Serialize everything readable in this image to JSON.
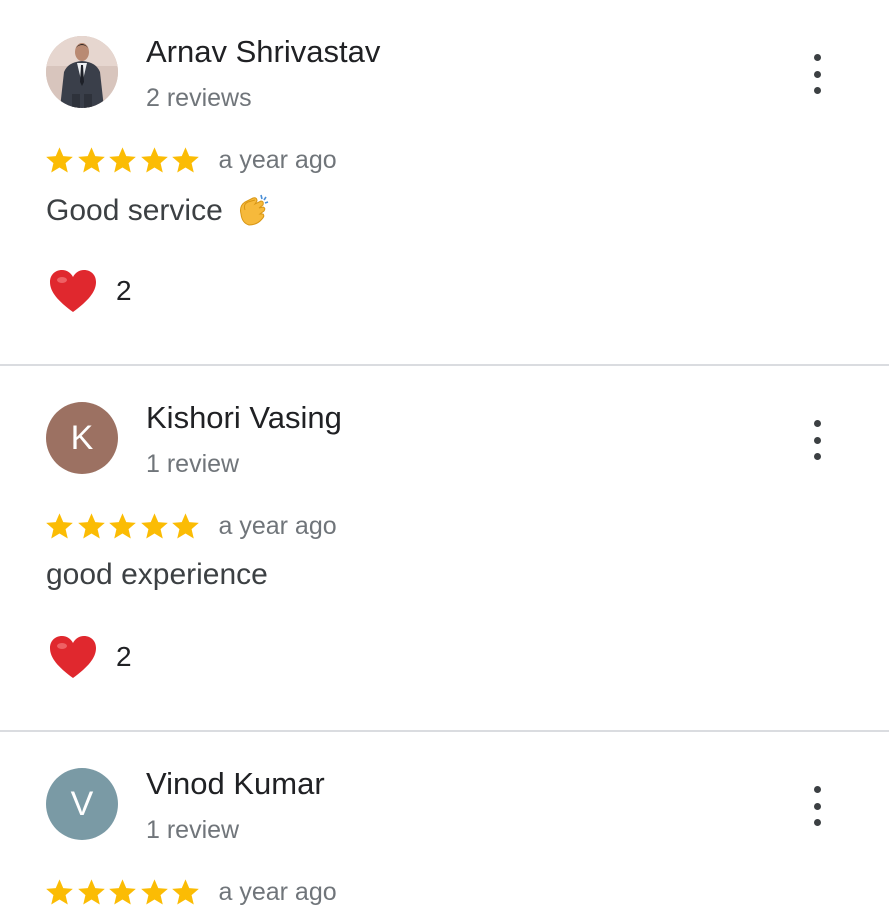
{
  "colors": {
    "star": "#fbbc04",
    "heart": "#e0282e",
    "divider": "#dadce0",
    "secondary_text": "#70757a",
    "avatar_k": "#9c7162",
    "avatar_v": "#7a9aa5"
  },
  "reviews": [
    {
      "name": "Arnav Shrivastav",
      "review_count": "2 reviews",
      "avatar": {
        "type": "photo",
        "icon": "person-in-suit-photo"
      },
      "stars": 5,
      "time": "a year ago",
      "text": "Good service",
      "emoji": "clapping-hands-emoji",
      "reaction": {
        "icon": "heart-icon",
        "count": "2"
      },
      "menu_icon": "more-vert-icon"
    },
    {
      "name": "Kishori Vasing",
      "review_count": "1 review",
      "avatar": {
        "type": "initial",
        "initial": "K",
        "color": "#9c7162"
      },
      "stars": 5,
      "time": "a year ago",
      "text": "good experience",
      "reaction": {
        "icon": "heart-icon",
        "count": "2"
      },
      "menu_icon": "more-vert-icon"
    },
    {
      "name": "Vinod Kumar",
      "review_count": "1 review",
      "avatar": {
        "type": "initial",
        "initial": "V",
        "color": "#7a9aa5"
      },
      "stars": 5,
      "time": "a year ago",
      "menu_icon": "more-vert-icon"
    }
  ]
}
